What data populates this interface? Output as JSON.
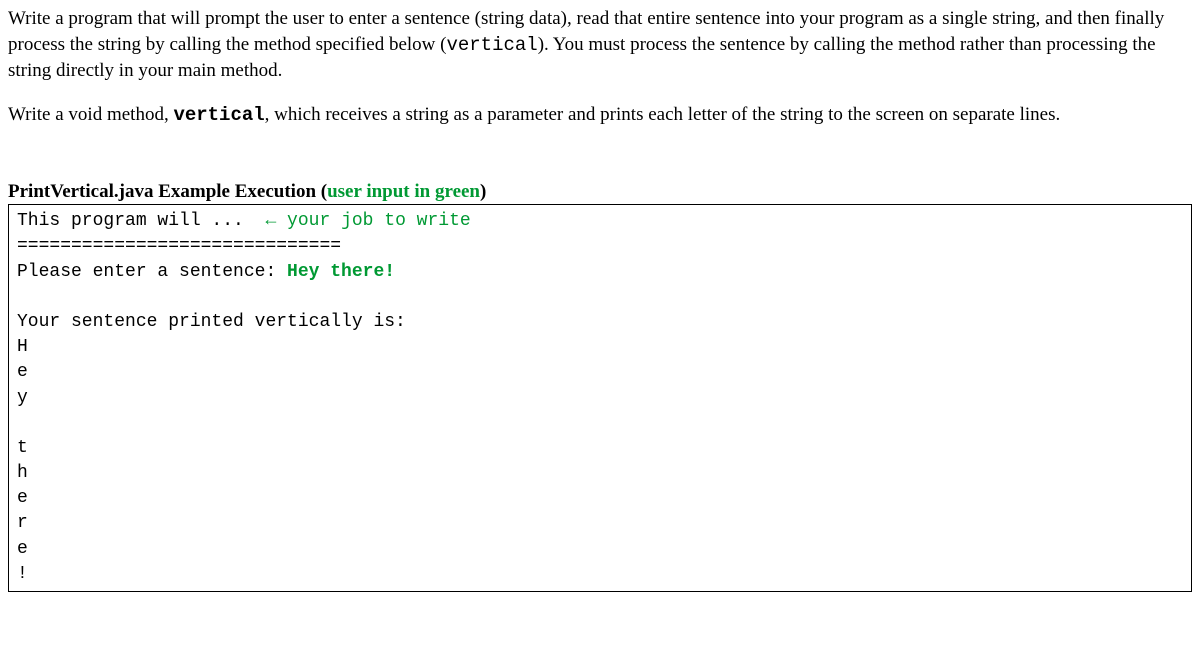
{
  "para1_seg1": "Write a program that will prompt the user to enter a sentence (string data), read that entire sentence into your program as a single string, and then finally process the string by calling the method specified below (",
  "para1_method": "vertical",
  "para1_seg2": "). You must process the sentence by calling the method rather than processing the string directly in your main method.",
  "para2_seg1": "Write a void method, ",
  "para2_method": "vertical",
  "para2_seg2": ", which receives a string as a parameter and prints each letter of the string to the screen on separate lines.",
  "heading_main": "PrintVertical.java Example Execution ",
  "heading_paren_open": "(",
  "heading_green": "user input in green",
  "heading_paren_close": ")",
  "code": {
    "line1_a": "This program will ...  ",
    "line1_b": "← your job to write",
    "line2": "==============================",
    "line3_a": "Please enter a sentence: ",
    "line3_b": "Hey there!",
    "blank": " ",
    "line5": "Your sentence printed vertically is:",
    "v1": "H",
    "v2": "e",
    "v3": "y",
    "v4": " ",
    "v5": "t",
    "v6": "h",
    "v7": "e",
    "v8": "r",
    "v9": "e",
    "v10": "!"
  }
}
